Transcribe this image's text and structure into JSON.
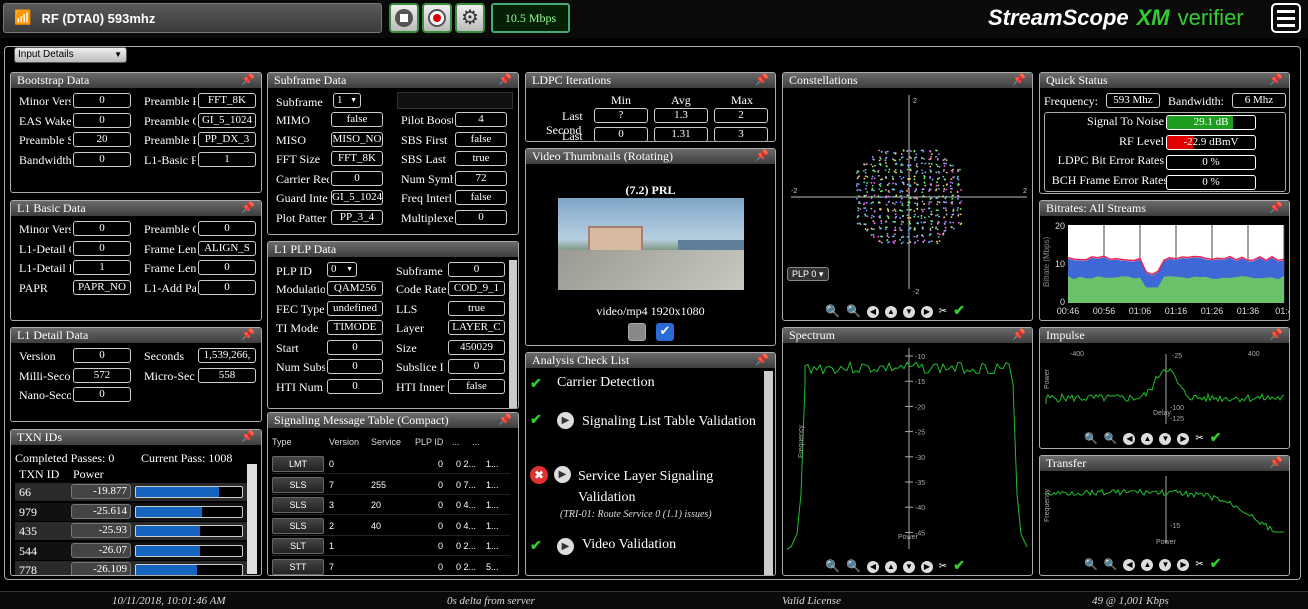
{
  "topbar": {
    "tuner_label": "RF (DTA0) 593mhz",
    "bitrate": "10.5 Mbps",
    "brand_main": "StreamScope",
    "brand_xm": "XM",
    "brand_verifier": "verifier"
  },
  "input_select": "Input Details",
  "bootstrap": {
    "title": "Bootstrap Data",
    "rows": [
      {
        "l": "Minor Vers",
        "v": "0",
        "l2": "Preamble F",
        "v2": "FFT_8K"
      },
      {
        "l": "EAS Wake",
        "v": "0",
        "l2": "Preamble C",
        "v2": "GI_5_1024"
      },
      {
        "l": "Preamble S",
        "v": "20",
        "l2": "Preamble F",
        "v2": "PP_DX_3"
      },
      {
        "l": "Bandwidth",
        "v": "0",
        "l2": "L1-Basic F",
        "v2": "1"
      }
    ]
  },
  "l1basic": {
    "title": "L1 Basic Data",
    "rows": [
      {
        "l": "Minor Vers",
        "v": "0",
        "l2": "Preamble C",
        "v2": "0"
      },
      {
        "l": "L1-Detail C",
        "v": "0",
        "l2": "Frame Len",
        "v2": "ALIGN_S"
      },
      {
        "l": "L1-Detail I",
        "v": "1",
        "l2": "Frame Len",
        "v2": "0"
      },
      {
        "l": "PAPR",
        "v": "PAPR_NO",
        "l2": "L1-Add Pa",
        "v2": "0"
      }
    ]
  },
  "l1detail": {
    "title": "L1 Detail Data",
    "rows": [
      {
        "l": "Version",
        "v": "0",
        "l2": "Seconds",
        "v2": "1,539,266,"
      },
      {
        "l": "Milli-Seco",
        "v": "572",
        "l2": "Micro-Sec",
        "v2": "558"
      },
      {
        "l": "Nano-Seco",
        "v": "0",
        "l2": "",
        "v2": ""
      }
    ]
  },
  "txn": {
    "title": "TXN IDs",
    "completed": "Completed Passes: 0",
    "current": "Current Pass: 1008",
    "col1": "TXN ID",
    "col2": "Power",
    "rows": [
      {
        "id": "66",
        "p": "-19.877",
        "bar": 0.78
      },
      {
        "id": "979",
        "p": "-25.614",
        "bar": 0.62
      },
      {
        "id": "435",
        "p": "-25.93",
        "bar": 0.6
      },
      {
        "id": "544",
        "p": "-26.07",
        "bar": 0.6
      },
      {
        "id": "778",
        "p": "-26.109",
        "bar": 0.58
      }
    ]
  },
  "subframe": {
    "title": "Subframe Data",
    "sel_label": "Subframe",
    "sel_val": "1",
    "rows": [
      {
        "l": "MIMO",
        "v": "false",
        "l2": "Pilot Boost",
        "v2": "4"
      },
      {
        "l": "MISO",
        "v": "MISO_NO",
        "l2": "SBS First",
        "v2": "false"
      },
      {
        "l": "FFT Size",
        "v": "FFT_8K",
        "l2": "SBS Last",
        "v2": "true"
      },
      {
        "l": "Carrier Rec",
        "v": "0",
        "l2": "Num Symb",
        "v2": "72"
      },
      {
        "l": "Guard Inte",
        "v": "GI_5_1024",
        "l2": "Freq Interl",
        "v2": "false"
      },
      {
        "l": "Plot Patter",
        "v": "PP_3_4",
        "l2": "Multiplexe",
        "v2": "0"
      }
    ]
  },
  "plp": {
    "title": "L1 PLP Data",
    "sel_label": "PLP ID",
    "sel_val": "0",
    "rows": [
      {
        "l": "Modulatio",
        "v": "QAM256",
        "l2": "Code Rate",
        "v2": "COD_9_1"
      },
      {
        "l": "FEC Type",
        "v": "undefined",
        "l2": "LLS",
        "v2": "true"
      },
      {
        "l": "TI Mode",
        "v": "TIMODE",
        "l2": "Layer",
        "v2": "LAYER_C"
      },
      {
        "l": "Start",
        "v": "0",
        "l2": "Size",
        "v2": "450029"
      },
      {
        "l": "Num Subs",
        "v": "0",
        "l2": "Subslice I",
        "v2": "0"
      },
      {
        "l": "HTI Num",
        "v": "0",
        "l2": "HTI Inner",
        "v2": "false"
      }
    ],
    "first_r": {
      "l2": "Subframe",
      "v2": "0"
    }
  },
  "sigtable": {
    "title": "Signaling Message Table (Compact)",
    "headers": [
      "Type",
      "Version",
      "Service",
      "PLP ID",
      "...",
      "..."
    ],
    "rows": [
      {
        "t": "LMT",
        "ver": "0",
        "svc": "",
        "plp": "0",
        "a": "0 2...",
        "b": "1..."
      },
      {
        "t": "SLS",
        "ver": "7",
        "svc": "255",
        "plp": "0",
        "a": "0 7...",
        "b": "1..."
      },
      {
        "t": "SLS",
        "ver": "3",
        "svc": "20",
        "plp": "0",
        "a": "0 4...",
        "b": "1..."
      },
      {
        "t": "SLS",
        "ver": "2",
        "svc": "40",
        "plp": "0",
        "a": "0 4...",
        "b": "1..."
      },
      {
        "t": "SLT",
        "ver": "1",
        "svc": "",
        "plp": "0",
        "a": "0 2...",
        "b": "1..."
      },
      {
        "t": "STT",
        "ver": "7",
        "svc": "",
        "plp": "0",
        "a": "0 2...",
        "b": "5..."
      }
    ]
  },
  "ldpc": {
    "title": "LDPC Iterations",
    "h_min": "Min",
    "h_avg": "Avg",
    "h_max": "Max",
    "r1": "Last",
    "r2": "Second",
    "r2b": "Last",
    "v1": [
      "?",
      "1.3",
      "2"
    ],
    "v2": [
      "0",
      "1.31",
      "3"
    ]
  },
  "video": {
    "title": "Video Thumbnails (Rotating)",
    "channel": "(7.2) PRL",
    "format": "video/mp4 1920x1080"
  },
  "checklist": {
    "title": "Analysis Check List",
    "items": [
      {
        "status": "ok",
        "label": "Carrier Detection",
        "sub": ""
      },
      {
        "status": "ok",
        "label": "Signaling List Table Validation",
        "sub": ""
      },
      {
        "status": "err",
        "label": "Service Layer Signaling Validation",
        "sub": "(TRI-01: Route Service 0 (1.1) issues)"
      },
      {
        "status": "ok",
        "label": "Video Validation",
        "sub": ""
      }
    ]
  },
  "constellations": {
    "title": "Constellations",
    "plp_select": "PLP 0",
    "ticks": [
      "2",
      "-2",
      "2",
      "-2"
    ]
  },
  "spectrum": {
    "title": "Spectrum",
    "ylabel": "Frequency",
    "xlabel": "Power",
    "ticks": [
      "-10",
      "-15",
      "-20",
      "-25",
      "-30",
      "-35",
      "-40",
      "-45"
    ]
  },
  "quick": {
    "title": "Quick Status",
    "freq_label": "Frequency:",
    "freq": "593 Mhz",
    "bw_label": "Bandwidth:",
    "bw": "6 Mhz",
    "snr_label": "Signal To Noise",
    "snr": "29.1 dB",
    "snr_level": 0.75,
    "rf_label": "RF Level",
    "rf": "-22.9 dBmV",
    "rf_level": 0.3,
    "ldpc_label": "LDPC Bit Error Rates",
    "ldpc": "0 %",
    "bch_label": "BCH Frame Error Rates",
    "bch": "0 %",
    "colors": {
      "snr": "#1e9e1e",
      "rf": "#e00000"
    }
  },
  "bitrates": {
    "title": "Bitrates: All Streams",
    "ylabel": "Bitrate (Mbps)",
    "yticks": [
      "20",
      "10",
      "0"
    ],
    "xticks": [
      "00:46",
      "00:56",
      "01:06",
      "01:16",
      "01:26",
      "01:36",
      "01:4"
    ]
  },
  "impulse": {
    "title": "Impulse",
    "ylabel": "Power",
    "xlabel": "Delay",
    "xticks": [
      "-400",
      "-25",
      "400"
    ],
    "yticks": [
      "-100",
      "-125"
    ]
  },
  "transfer": {
    "title": "Transfer",
    "ylabel": "Frequency",
    "xlabel": "Power",
    "tick": "-15"
  },
  "status": {
    "datetime": "10/11/2018, 10:01:46 AM",
    "delta": "0s delta from server",
    "license": "Valid License",
    "rate": "49 @ 1,001 Kbps"
  }
}
